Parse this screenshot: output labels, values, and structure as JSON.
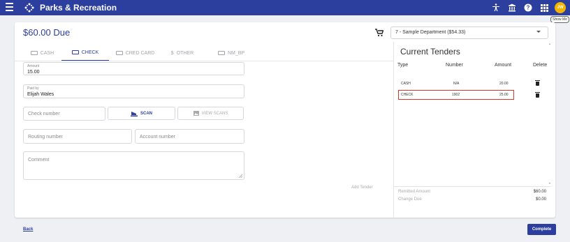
{
  "app": {
    "title": "Parks & Recreation",
    "avatar_initials": "JW",
    "show_me": "Show Me"
  },
  "payment": {
    "due": "$60.00 Due",
    "department": "7 - Sample Department ($54.33)"
  },
  "tabs": [
    {
      "label": "CASH",
      "active": false
    },
    {
      "label": "CHECK",
      "active": true
    },
    {
      "label": "CRED CARD",
      "active": false
    },
    {
      "label": "OTHER",
      "active": false
    },
    {
      "label": "NM_BP",
      "active": false
    }
  ],
  "form": {
    "amount": {
      "label": "Amount",
      "value": "15.00"
    },
    "paid_by": {
      "label": "Paid by",
      "value": "Elijah Wales"
    },
    "check_number": {
      "placeholder": "Check number"
    },
    "scan_label": "SCAN",
    "view_scans_label": "VIEW SCANS",
    "routing_number": {
      "placeholder": "Routing number"
    },
    "account_number": {
      "placeholder": "Account number"
    },
    "comment": {
      "placeholder": "Comment"
    },
    "add_tender": "Add Tender"
  },
  "tenders": {
    "title": "Current Tenders",
    "headers": {
      "type": "Type",
      "number": "Number",
      "amount": "Amount",
      "delete": "Delete"
    },
    "rows": [
      {
        "type": "CASH",
        "number": "N/A",
        "amount": "20.00"
      },
      {
        "type": "CHECK",
        "number": "1902",
        "amount": "25.00"
      }
    ],
    "remitted_label": "Remitted Amount",
    "remitted_value": "$60.00",
    "change_label": "Change Due",
    "change_value": "$0.00"
  },
  "footer": {
    "back": "Back",
    "complete": "Complete"
  },
  "colors": {
    "primary": "#2c3e9e",
    "highlight": "#d13a2a",
    "avatar": "#f5b400"
  }
}
